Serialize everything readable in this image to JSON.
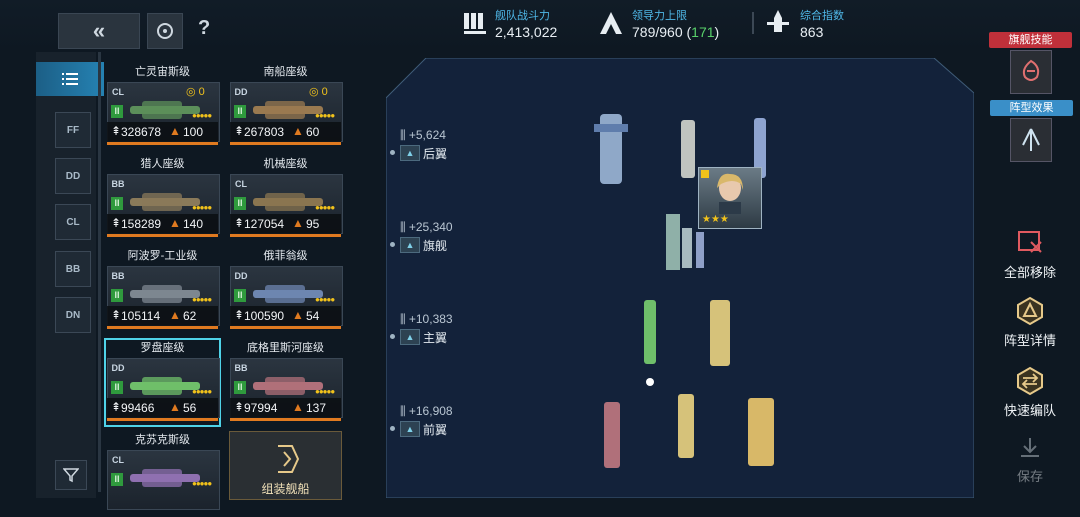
{
  "header": {
    "fleet_power_label": "舰队战斗力",
    "fleet_power_value": "2,413,022",
    "leadership_label": "领导力上限",
    "leadership_value": "789/960",
    "leadership_bonus": "171",
    "composite_label": "综合指数",
    "composite_value": "863",
    "help_label": "?"
  },
  "rail": {
    "items": [
      "FF",
      "DD",
      "CL",
      "BB",
      "DN"
    ]
  },
  "cards": [
    {
      "name": "亡灵宙斯级",
      "cls": "CL",
      "tier": "II",
      "power": "328678",
      "cost": "100",
      "count": "0",
      "color": "#5c8f5a"
    },
    {
      "name": "南船座级",
      "cls": "DD",
      "tier": "II",
      "power": "267803",
      "cost": "60",
      "count": "0",
      "color": "#9a7a50"
    },
    {
      "name": "猎人座级",
      "cls": "BB",
      "tier": "II",
      "power": "158289",
      "cost": "140",
      "count": "",
      "color": "#8a7a5a"
    },
    {
      "name": "机械座级",
      "cls": "CL",
      "tier": "II",
      "power": "127054",
      "cost": "95",
      "count": "",
      "color": "#8a7550"
    },
    {
      "name": "阿波罗-工业级",
      "cls": "BB",
      "tier": "II",
      "power": "105114",
      "cost": "62",
      "count": "",
      "color": "#7d8790"
    },
    {
      "name": "俄菲翁级",
      "cls": "DD",
      "tier": "II",
      "power": "100590",
      "cost": "54",
      "count": "",
      "color": "#6d86b0"
    },
    {
      "name": "罗盘座级",
      "cls": "DD",
      "tier": "II",
      "power": "99466",
      "cost": "56",
      "count": "",
      "color": "#6fbf6a"
    },
    {
      "name": "底格里斯河座级",
      "cls": "BB",
      "tier": "II",
      "power": "97994",
      "cost": "137",
      "count": "",
      "color": "#b0707a"
    },
    {
      "name": "克苏克斯级",
      "cls": "CL",
      "tier": "II",
      "power": "",
      "cost": "",
      "count": "",
      "color": "#8f70b0"
    }
  ],
  "assemble_label": "组装舰船",
  "formation": {
    "rows": [
      {
        "power": "+5,624",
        "label": "后翼"
      },
      {
        "power": "+25,340",
        "label": "旗舰"
      },
      {
        "power": "+10,383",
        "label": "主翼"
      },
      {
        "power": "+16,908",
        "label": "前翼"
      }
    ],
    "captain_stars": "★★★"
  },
  "right_panel": {
    "flagship_skill": "旗舰技能",
    "formation_effect": "阵型效果",
    "remove_all": "全部移除",
    "formation_detail": "阵型详情",
    "quick_team": "快速编队",
    "save": "保存"
  },
  "colors": {
    "accent": "#4fb8e8",
    "highlight": "#4fd3e8",
    "bonus_green": "#58d06a",
    "skill_red": "#c0303a"
  }
}
